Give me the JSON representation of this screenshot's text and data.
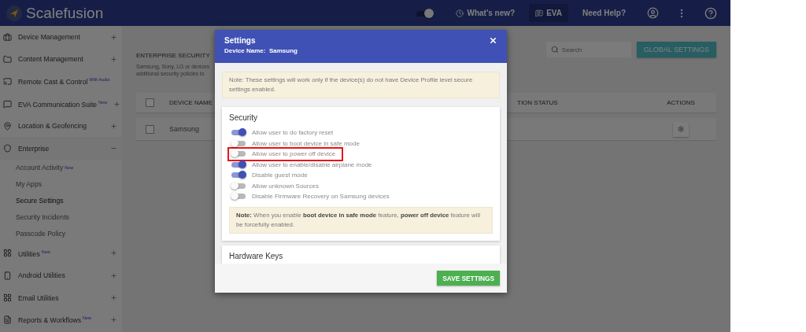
{
  "header": {
    "brand": "Scalefusion",
    "theme_toggle": {
      "on": true
    },
    "links": [
      {
        "label": "What's new?",
        "kind": "icon-link"
      },
      {
        "label": "EVA",
        "kind": "chip"
      },
      {
        "label": "Need Help?",
        "kind": "link"
      }
    ]
  },
  "sidebar": {
    "items": [
      {
        "label": "Device Management",
        "expanded": false
      },
      {
        "label": "Content Management",
        "expanded": false
      },
      {
        "label": "Remote Cast & Control",
        "badge": "With Audio"
      },
      {
        "label": "EVA Communication Suite",
        "badge": "New",
        "expanded": false
      },
      {
        "label": "Location & Geofencing",
        "expanded": false
      },
      {
        "label": "Enterprise",
        "expanded": true,
        "children": [
          {
            "label": "Account Activity",
            "badge": "New",
            "selected": false
          },
          {
            "label": "My Apps",
            "selected": false
          },
          {
            "label": "Secure Settings",
            "selected": true
          },
          {
            "label": "Security Incidents",
            "selected": false
          },
          {
            "label": "Passcode Policy",
            "selected": false
          }
        ]
      },
      {
        "label": "Utilities",
        "badge": "New",
        "expanded": false
      },
      {
        "label": "Android Utilities",
        "expanded": false
      },
      {
        "label": "Email Utilities",
        "expanded": false
      },
      {
        "label": "Reports & Workflows",
        "badge": "New",
        "expanded": false
      }
    ]
  },
  "content": {
    "title": "ENTERPRISE SECURITY",
    "description_lines": [
      "Samsung, Sony, LG or devices",
      "additional security policies to"
    ],
    "search": {
      "placeholder": "Search"
    },
    "global_button": "GLOBAL SETTINGS",
    "table": {
      "header_checked": false,
      "columns": [
        "DEVICE NAME",
        "TION STATUS",
        "ACTIONS"
      ],
      "rows": [
        {
          "device_name": "Samsung",
          "checked": false
        }
      ]
    }
  },
  "modal": {
    "title": "Settings",
    "device_label": "Device Name:",
    "device_name": "Samsung",
    "note": "Note: These settings will work only if the device(s) do not have Device Profile level secure settings enabled.",
    "sections": [
      {
        "title": "Security",
        "settings": [
          {
            "label": "Allow user to do factory reset",
            "on": true,
            "highlighted": false
          },
          {
            "label": "Allow user to boot device in safe mode",
            "on": false,
            "highlighted": false
          },
          {
            "label": "Allow user to power off device",
            "on": false,
            "highlighted": true
          },
          {
            "label": "Allow user to enable/disable airplane mode",
            "on": true,
            "highlighted": false
          },
          {
            "label": "Disable guest mode",
            "on": true,
            "highlighted": false
          },
          {
            "label": "Allow unknown Sources",
            "on": false,
            "highlighted": false
          },
          {
            "label": "Disable Firmware Recovery on Samsung devices",
            "on": false,
            "highlighted": false
          }
        ],
        "note": "**Note:** When you enable **boot device in safe mode** feature, **power off device** feature will be forcefully enabled."
      },
      {
        "title": "Hardware Keys"
      }
    ],
    "save_button": "SAVE SETTINGS"
  }
}
